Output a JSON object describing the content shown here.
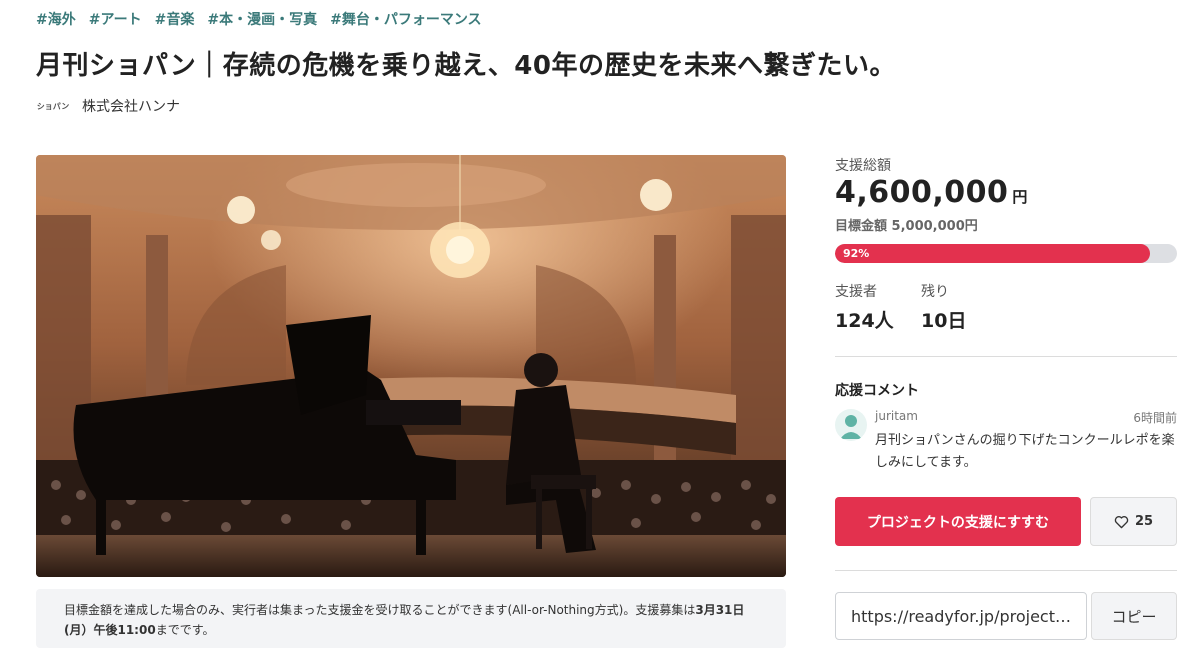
{
  "tags": [
    "#海外",
    "#アート",
    "#音楽",
    "#本・漫画・写真",
    "#舞台・パフォーマンス"
  ],
  "title": "月刊ショパン｜存続の危機を乗り越え、40年の歴史を未来へ繋ぎたい。",
  "owner": {
    "logo_text": "ショパン",
    "name": "株式会社ハンナ"
  },
  "funding": {
    "total_label": "支援総額",
    "total_value": "4,600,000",
    "currency": "円",
    "goal_label": "目標金額",
    "goal_value": "5,000,000円",
    "progress_percent": 92,
    "progress_text": "92%",
    "progress_color": "#e3314e",
    "supporters_label": "支援者",
    "supporters_value": "124人",
    "remaining_label": "残り",
    "remaining_value": "10日"
  },
  "comments": {
    "heading": "応援コメント",
    "items": [
      {
        "user": "juritam",
        "time": "6時間前",
        "text": "月刊ショパンさんの掘り下げたコンクールレポを楽しみにしてます。"
      }
    ]
  },
  "actions": {
    "support_label": "プロジェクトの支援にすすむ",
    "favorite_count": "25",
    "share_url": "https://readyfor.jp/projects/chopin",
    "copy_label": "コピー"
  },
  "notice": {
    "text_pre": "目標金額を達成した場合のみ、実行者は集まった支援金を受け取ることができます(All-or-Nothing方式)。支援募集は",
    "deadline": "3月31日(月）午後11:00",
    "text_post": "までです。"
  },
  "icons": {
    "heart": "heart-icon",
    "avatar": "user-avatar-icon"
  },
  "colors": {
    "accent": "#e3314e",
    "tag": "#3b7a7a"
  }
}
